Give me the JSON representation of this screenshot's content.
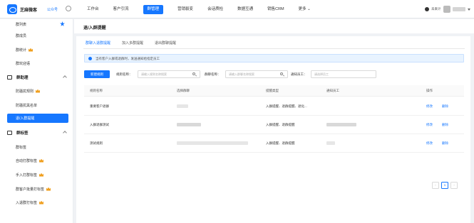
{
  "app": {
    "brand": "芝麻微客",
    "brand_sub": "公众号"
  },
  "nav": [
    "工作台",
    "客户引流",
    "群管理",
    "营销裂变",
    "会话质检",
    "数据互通",
    "销售CRM",
    "更多"
  ],
  "nav_active_index": 2,
  "user": {
    "label": "未来计"
  },
  "sidebar": {
    "items": [
      {
        "label": "群列表",
        "type": "child",
        "star": true
      },
      {
        "label": "群成员",
        "type": "child"
      },
      {
        "label": "群统计",
        "type": "child",
        "vip": true
      },
      {
        "label": "群欢迎语",
        "type": "child"
      },
      {
        "label": "群助理",
        "type": "group",
        "icon": "group-assist-icon"
      },
      {
        "label": "防骚扰规则",
        "type": "child",
        "vip": true
      },
      {
        "label": "防骚扰黑名单",
        "type": "child"
      },
      {
        "label": "退/入群提醒",
        "type": "child",
        "active": true
      },
      {
        "label": "群标签",
        "type": "group",
        "icon": "tag-icon"
      },
      {
        "label": "群标签",
        "type": "child"
      },
      {
        "label": "自动打群标签",
        "type": "child",
        "vip": true
      },
      {
        "label": "手入打群标签",
        "type": "child",
        "vip": true
      },
      {
        "label": "群客户批量打标签",
        "type": "child",
        "vip": true
      },
      {
        "label": "入退群打标签",
        "type": "child",
        "vip": true
      }
    ]
  },
  "page": {
    "title": "退/入群提醒"
  },
  "tabs": [
    "群聊入退群提醒",
    "加入多群提醒",
    "退出群聊提醒"
  ],
  "tab_active_index": 0,
  "info": "当有客户入群或退群时，发送通知给指定员工",
  "filters": {
    "new_button": "新建规则",
    "rule_name_label": "规则名称：",
    "rule_name_placeholder": "请输入规则名称搜索",
    "group_name_label": "群聊名称：",
    "group_name_placeholder": "请输入群聊名称搜索",
    "notify_label": "通知员工：",
    "notify_placeholder": "请选择员工"
  },
  "table": {
    "headers": [
      "规则名称",
      "选择群聊",
      "提醒类型",
      "通知员工",
      "操作"
    ],
    "rows": [
      {
        "name": "重要客户退群",
        "type": "入群提醒、退群提醒、退化...",
        "actions": [
          "修改",
          "删除"
        ]
      },
      {
        "name": "入群退群测试",
        "type": "入群提醒、退群提醒",
        "actions": [
          "修改",
          "删除"
        ]
      },
      {
        "name": "测试规则",
        "type": "入群提醒、退群提醒",
        "actions": [
          "修改",
          "删除"
        ]
      }
    ]
  },
  "pagination": {
    "prev": "‹",
    "current": "1",
    "next": "›"
  },
  "colors": {
    "primary": "#1677ff",
    "info_bg": "#e8f3ff",
    "vip": "#f0a020"
  }
}
